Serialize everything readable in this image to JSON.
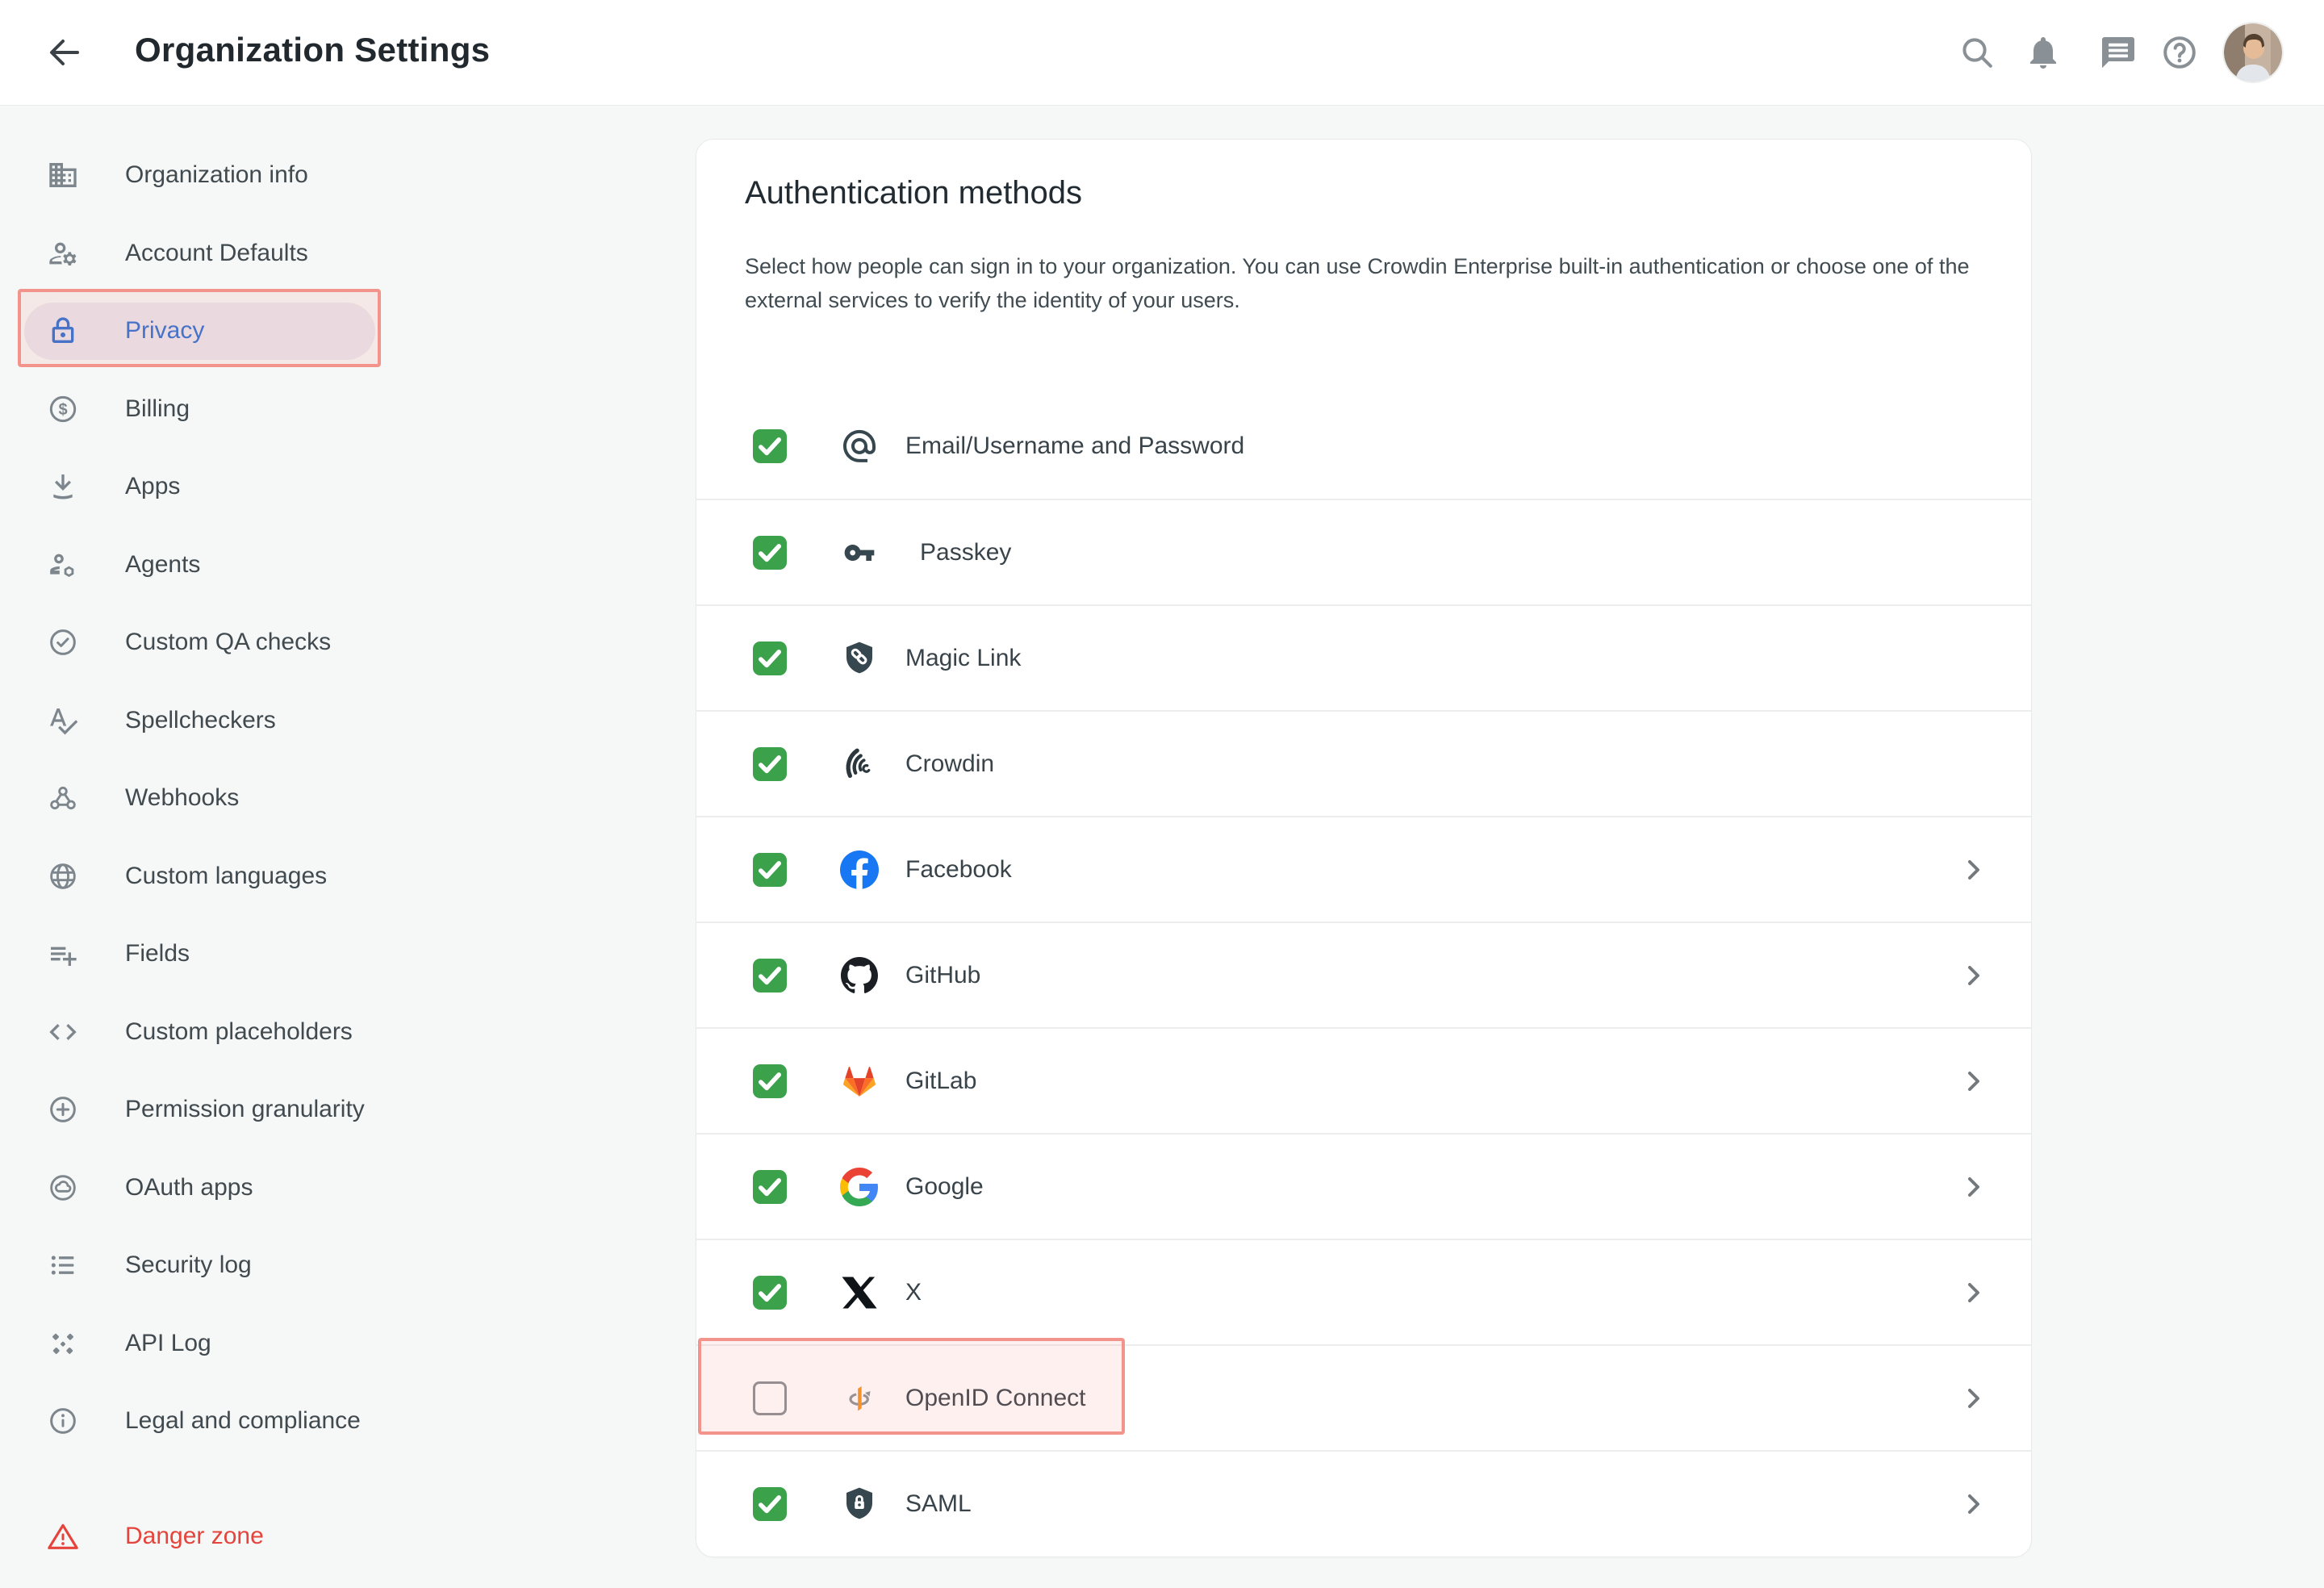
{
  "topbar": {
    "title": "Organization Settings",
    "icons": [
      "search-icon",
      "notifications-icon",
      "messages-icon",
      "help-icon"
    ],
    "avatar": "user-avatar"
  },
  "sidebar": {
    "items": [
      {
        "label": "Organization info",
        "icon": "organization-icon"
      },
      {
        "label": "Account Defaults",
        "icon": "account-defaults-icon"
      },
      {
        "label": "Privacy",
        "icon": "lock-icon",
        "active": true
      },
      {
        "label": "Billing",
        "icon": "billing-icon"
      },
      {
        "label": "Apps",
        "icon": "apps-icon"
      },
      {
        "label": "Agents",
        "icon": "agents-icon"
      },
      {
        "label": "Custom QA checks",
        "icon": "qa-check-icon"
      },
      {
        "label": "Spellcheckers",
        "icon": "spellcheck-icon"
      },
      {
        "label": "Webhooks",
        "icon": "webhook-icon"
      },
      {
        "label": "Custom languages",
        "icon": "globe-icon"
      },
      {
        "label": "Fields",
        "icon": "fields-icon"
      },
      {
        "label": "Custom placeholders",
        "icon": "code-icon"
      },
      {
        "label": "Permission granularity",
        "icon": "plus-circle-icon"
      },
      {
        "label": "OAuth apps",
        "icon": "oauth-icon"
      },
      {
        "label": "Security log",
        "icon": "list-icon"
      },
      {
        "label": "API Log",
        "icon": "api-log-icon"
      },
      {
        "label": "Legal and compliance",
        "icon": "info-icon"
      },
      {
        "label": "Danger zone",
        "icon": "warning-icon",
        "danger": true
      }
    ]
  },
  "card": {
    "title": "Authentication methods",
    "description": "Select how people can sign in to your organization. You can use Crowdin Enterprise built-in authentication or choose one of the external services to verify the identity of your users.",
    "methods": [
      {
        "label": "Email/Username and Password",
        "icon": "at-icon",
        "checked": true,
        "chevron": false
      },
      {
        "label": "Passkey",
        "icon": "passkey-icon",
        "checked": true,
        "chevron": false
      },
      {
        "label": "Magic Link",
        "icon": "magic-link-icon",
        "checked": true,
        "chevron": false
      },
      {
        "label": "Crowdin",
        "icon": "crowdin-icon",
        "checked": true,
        "chevron": false
      },
      {
        "label": "Facebook",
        "icon": "facebook-icon",
        "checked": true,
        "chevron": true
      },
      {
        "label": "GitHub",
        "icon": "github-icon",
        "checked": true,
        "chevron": true
      },
      {
        "label": "GitLab",
        "icon": "gitlab-icon",
        "checked": true,
        "chevron": true
      },
      {
        "label": "Google",
        "icon": "google-icon",
        "checked": true,
        "chevron": true
      },
      {
        "label": "X",
        "icon": "x-icon",
        "checked": true,
        "chevron": true
      },
      {
        "label": "OpenID Connect",
        "icon": "openid-icon",
        "checked": false,
        "chevron": true,
        "highlighted": true
      },
      {
        "label": "SAML",
        "icon": "saml-icon",
        "checked": true,
        "chevron": true
      }
    ]
  },
  "colors": {
    "checkbox_green": "#3ba24b",
    "annotation_red": "#f2948b",
    "active_blue": "#2d6fd3",
    "danger_red": "#e5443c",
    "background": "#f6f7f7"
  }
}
